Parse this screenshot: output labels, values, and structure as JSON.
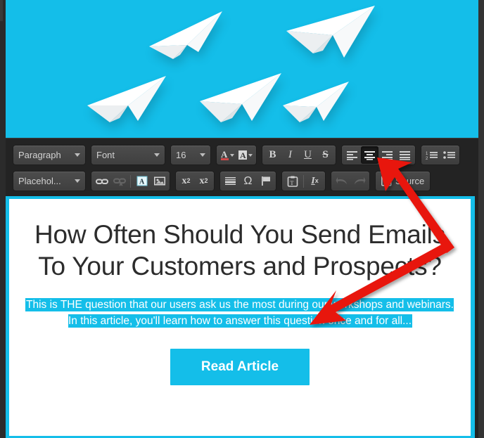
{
  "hero": {
    "background_color": "#14bee9",
    "icon": "paper-airplane-icon",
    "planes": 5,
    "alt": "Five white paper airplanes flying on a cyan sky background"
  },
  "toolbar": {
    "background_color": "#232323",
    "row1": {
      "paragraph_format": {
        "value": "Paragraph",
        "icon": "chevron-down-icon"
      },
      "font_family": {
        "value": "Font",
        "icon": "chevron-down-icon"
      },
      "font_size": {
        "value": "16",
        "icon": "chevron-down-icon"
      },
      "text_color": {
        "label": "A",
        "icon": "text-color-icon"
      },
      "background_color": {
        "label": "A",
        "icon": "background-color-icon"
      },
      "bold": {
        "label": "B",
        "icon": "bold-icon"
      },
      "italic": {
        "label": "I",
        "icon": "italic-icon"
      },
      "underline": {
        "label": "U",
        "icon": "underline-icon"
      },
      "strikethrough": {
        "label": "S",
        "icon": "strikethrough-icon"
      },
      "align_left": {
        "icon": "align-left-icon",
        "active": false
      },
      "align_center": {
        "icon": "align-center-icon",
        "active": true
      },
      "align_right": {
        "icon": "align-right-icon",
        "active": false
      },
      "align_justify": {
        "icon": "align-justify-icon",
        "active": false
      },
      "numbered_list": {
        "icon": "numbered-list-icon"
      },
      "bulleted_list": {
        "icon": "bulleted-list-icon"
      }
    },
    "row2": {
      "placeholder": {
        "value": "Placehol...",
        "icon": "chevron-down-icon"
      },
      "link": {
        "icon": "link-icon",
        "disabled": false
      },
      "unlink": {
        "icon": "unlink-icon",
        "disabled": true
      },
      "anchor": {
        "icon": "anchor-icon",
        "label": "A"
      },
      "image": {
        "icon": "image-icon"
      },
      "subscript": {
        "icon": "subscript-icon",
        "label": "x₂"
      },
      "superscript": {
        "icon": "superscript-icon",
        "label": "x²"
      },
      "horizontal_rule": {
        "icon": "horizontal-rule-icon"
      },
      "special_character": {
        "icon": "omega-icon",
        "label": "Ω"
      },
      "flag": {
        "icon": "flag-icon"
      },
      "paste_as_text": {
        "icon": "paste-text-icon"
      },
      "remove_format": {
        "icon": "remove-format-icon",
        "label": "Ix"
      },
      "undo": {
        "icon": "undo-arrow-icon",
        "disabled": true
      },
      "redo": {
        "icon": "redo-arrow-icon",
        "disabled": true
      },
      "source": {
        "label": "Source",
        "icon": "source-code-icon"
      }
    }
  },
  "content": {
    "headline": "How Often Should You Send Emails To Your Customers and Prospects?",
    "paragraph": "This is THE question that our users ask us the most during our workshops and webinars. In this article, you'll learn how to answer this question once and for all...",
    "paragraph_selected": true,
    "selection_color": "#14bee9",
    "cta_button": {
      "label": "Read Article",
      "color": "#14bee9"
    }
  },
  "annotation": {
    "type": "double-headed-arrow",
    "color": "#e81309",
    "points_to_top": "align-center-icon",
    "points_to_bottom": "selected-paragraph-text"
  }
}
